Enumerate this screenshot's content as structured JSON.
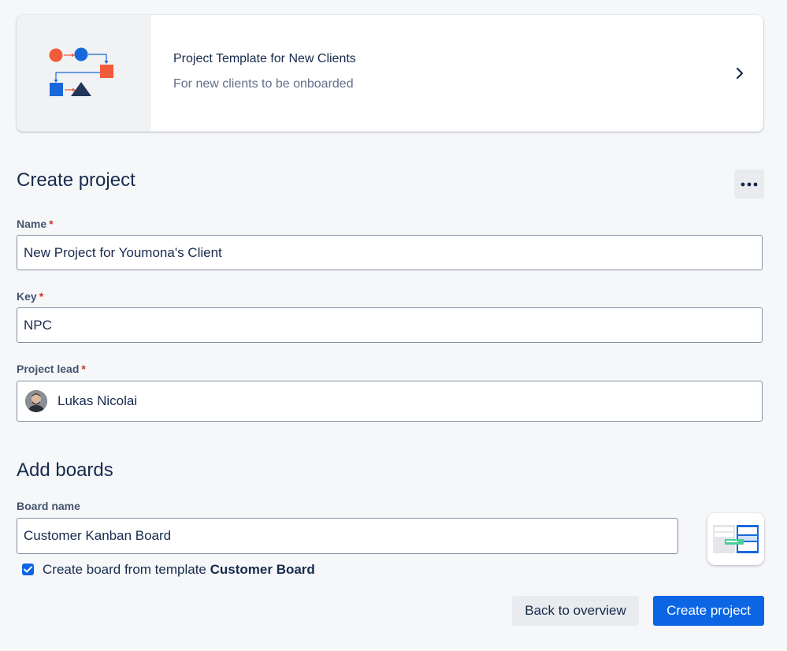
{
  "template": {
    "title": "Project Template for New Clients",
    "subtitle": "For new clients to be onboarded"
  },
  "create_project": {
    "heading": "Create project",
    "name_label": "Name",
    "name_value": "New Project for Youmona's Client",
    "key_label": "Key",
    "key_value": "NPC",
    "lead_label": "Project lead",
    "lead_value": "Lukas Nicolai",
    "required_mark": "*"
  },
  "boards": {
    "heading": "Add boards",
    "board_name_label": "Board name",
    "board_name_value": "Customer Kanban Board",
    "checkbox_text": "Create board from template",
    "checkbox_template": "Customer Board",
    "checkbox_checked": true
  },
  "actions": {
    "back_label": "Back to overview",
    "create_label": "Create project"
  },
  "colors": {
    "primary": "#0c66e4",
    "text": "#172b4d",
    "accent_orange": "#f15b39",
    "accent_blue": "#1868db",
    "required": "#c9372c"
  },
  "icons": [
    "template-illustration",
    "chevron-right-icon",
    "more-icon",
    "check-icon",
    "board-template-thumbnail"
  ]
}
